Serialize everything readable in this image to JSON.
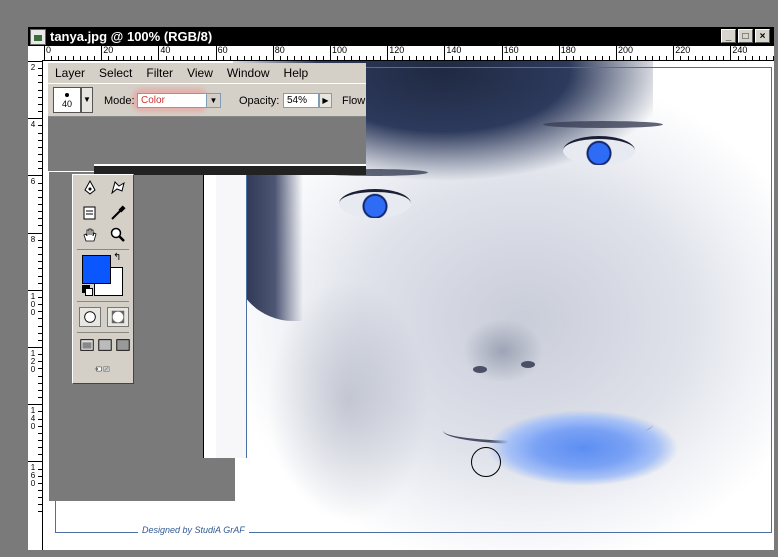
{
  "window": {
    "title": "tanya.jpg @ 100% (RGB/8)",
    "buttons": [
      "_",
      "□",
      "×"
    ]
  },
  "ruler": {
    "top_labels": [
      "0",
      "20",
      "40",
      "60",
      "80",
      "100",
      "120",
      "140",
      "160",
      "180",
      "200",
      "220",
      "240"
    ],
    "left_labels": [
      "2",
      "4",
      "6",
      "8",
      "1\n0\n0",
      "1\n2\n0",
      "1\n4\n0",
      "1\n6\n0"
    ]
  },
  "menu": {
    "items": [
      "Layer",
      "Select",
      "Filter",
      "View",
      "Window",
      "Help"
    ]
  },
  "options": {
    "brush_size": "40",
    "mode_label": "Mode:",
    "mode_value": "Color",
    "opacity_label": "Opacity:",
    "opacity_value": "54%",
    "flow_label": "Flow"
  },
  "toolbox": {
    "foreground_color": "#0a56ff",
    "background_color": "#ffffff",
    "icons": [
      "pen-icon",
      "custom-shape-icon",
      "notes-icon",
      "eyedropper-icon",
      "hand-icon",
      "zoom-icon",
      "standard-mode-icon",
      "quick-mask-icon",
      "standard-screen-icon",
      "full-screen-menu-icon",
      "full-screen-icon",
      "jump-to-imageready-icon"
    ]
  },
  "canvas": {
    "signature": "Designed by StudiA GrAF",
    "brush_color": "#5c8ef2"
  }
}
